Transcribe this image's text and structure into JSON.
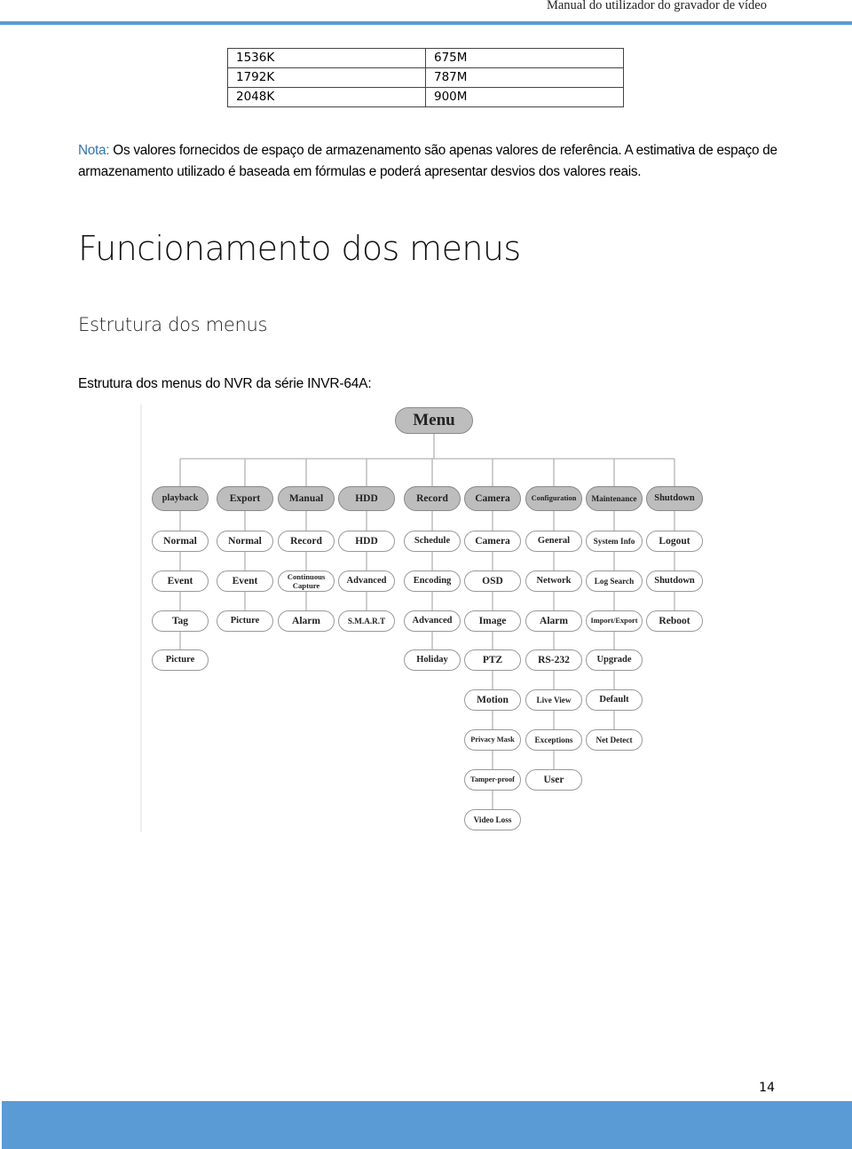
{
  "header": {
    "title": "Manual do utilizador do gravador de vídeo"
  },
  "storage_table": {
    "rows": [
      [
        "1536K",
        "675M"
      ],
      [
        "1792K",
        "787M"
      ],
      [
        "2048K",
        "900M"
      ]
    ]
  },
  "note": {
    "label": "Nota:",
    "text": " Os valores fornecidos de espaço de armazenamento são apenas valores de referência. A estimativa de espaço de armazenamento utilizado é baseada em fórmulas e poderá apresentar desvios dos valores reais."
  },
  "section_title": "Funcionamento dos menus",
  "subsection_title": "Estrutura dos menus",
  "caption": "Estrutura dos menus do NVR da série INVR-64A:",
  "menu_tree": {
    "root": "Menu",
    "columns": [
      {
        "label": "playback",
        "children": [
          "Normal",
          "Event",
          "Tag",
          "Picture"
        ]
      },
      {
        "label": "Export",
        "children": [
          "Normal",
          "Event",
          "Picture"
        ]
      },
      {
        "label": "Manual",
        "children": [
          "Record",
          "Continuous Capture",
          "Alarm"
        ]
      },
      {
        "label": "HDD",
        "children": [
          "HDD",
          "Advanced",
          "S.M.A.R.T"
        ]
      },
      {
        "label": "Record",
        "children": [
          "Schedule",
          "Encoding",
          "Advanced",
          "Holiday"
        ]
      },
      {
        "label": "Camera",
        "children": [
          "Camera",
          "OSD",
          "Image",
          "PTZ",
          "Motion",
          "Privacy Mask",
          "Tamper-proof",
          "Video Loss"
        ]
      },
      {
        "label": "Configuration",
        "children": [
          "General",
          "Network",
          "Alarm",
          "RS-232",
          "Live View",
          "Exceptions",
          "User"
        ]
      },
      {
        "label": "Maintenance",
        "children": [
          "System Info",
          "Log Search",
          "Import/Export",
          "Upgrade",
          "Default",
          "Net Detect"
        ]
      },
      {
        "label": "Shutdown",
        "children": [
          "Logout",
          "Shutdown",
          "Reboot"
        ]
      }
    ]
  },
  "page_number": "14",
  "colors": {
    "accent": "#5b9bd5",
    "note_label": "#2e74b5",
    "node_fill_top": "#bdbdbd",
    "node_border": "#999999"
  }
}
